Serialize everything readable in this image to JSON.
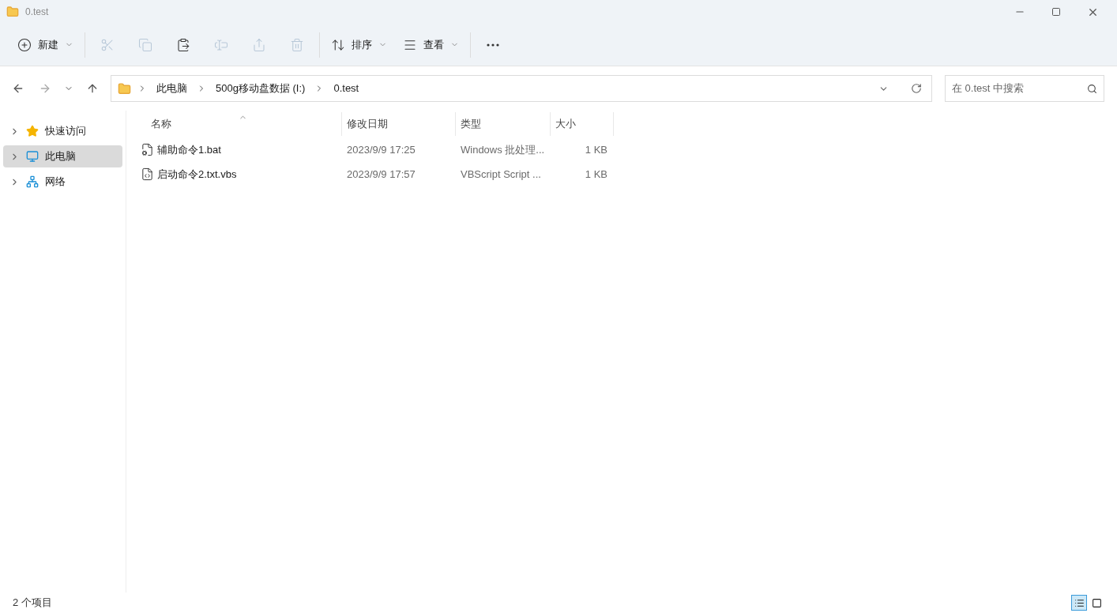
{
  "window": {
    "title": "0.test"
  },
  "toolbar": [
    {
      "kind": "new",
      "label": "新建",
      "disabled": false
    },
    {
      "kind": "cut",
      "disabled": true
    },
    {
      "kind": "copy",
      "disabled": true
    },
    {
      "kind": "paste",
      "disabled": false
    },
    {
      "kind": "rename",
      "disabled": true
    },
    {
      "kind": "share",
      "disabled": true
    },
    {
      "kind": "delete",
      "disabled": true
    },
    {
      "kind": "sort",
      "label": "排序",
      "disabled": false
    },
    {
      "kind": "view",
      "label": "查看",
      "disabled": false
    },
    {
      "kind": "more",
      "disabled": false
    }
  ],
  "address": {
    "crumbs": [
      "此电脑",
      "500g移动盘数据 (I:)",
      "0.test"
    ]
  },
  "search": {
    "placeholder": "在 0.test 中搜索"
  },
  "sidebar": {
    "items": [
      {
        "kind": "star",
        "label": "快速访问",
        "selected": false
      },
      {
        "kind": "pc",
        "label": "此电脑",
        "selected": true
      },
      {
        "kind": "network",
        "label": "网络",
        "selected": false
      }
    ]
  },
  "table": {
    "columns": [
      "名称",
      "修改日期",
      "类型",
      "大小"
    ],
    "rows": [
      {
        "kind": "bat",
        "name": "辅助命令1.bat",
        "date": "2023/9/9 17:25",
        "type": "Windows 批处理...",
        "size": "1 KB"
      },
      {
        "kind": "vbs",
        "name": "启动命令2.txt.vbs",
        "date": "2023/9/9 17:57",
        "type": "VBScript Script ...",
        "size": "1 KB"
      }
    ]
  },
  "status_bar": {
    "count": "2 个项目",
    "views": [
      {
        "kind": "details",
        "selected": true
      },
      {
        "kind": "tiles",
        "selected": false
      }
    ]
  }
}
